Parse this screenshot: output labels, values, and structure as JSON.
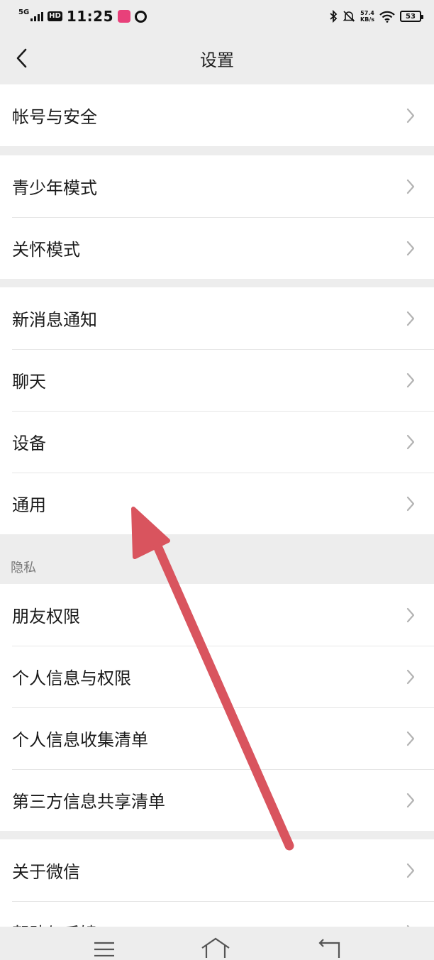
{
  "status_bar": {
    "network": "5G",
    "hd": "HD",
    "time": "11:25",
    "speed_value": "57.4",
    "speed_unit": "KB/s",
    "battery": "53"
  },
  "header": {
    "title": "设置"
  },
  "groups": [
    {
      "items": [
        "帐号与安全"
      ]
    },
    {
      "items": [
        "青少年模式",
        "关怀模式"
      ]
    },
    {
      "items": [
        "新消息通知",
        "聊天",
        "设备",
        "通用"
      ]
    },
    {
      "items": [
        "朋友权限",
        "个人信息与权限",
        "个人信息收集清单",
        "第三方信息共享清单"
      ]
    },
    {
      "items": [
        "关于微信",
        "帮助与反馈"
      ]
    }
  ],
  "section_labels": {
    "privacy": "隐私"
  },
  "annotation": {
    "type": "arrow",
    "color": "#d9545e"
  },
  "colors": {
    "page_bg": "#ededed",
    "card_bg": "#ffffff",
    "divider": "#e6e6e6",
    "chevron": "#b3b3b3"
  }
}
